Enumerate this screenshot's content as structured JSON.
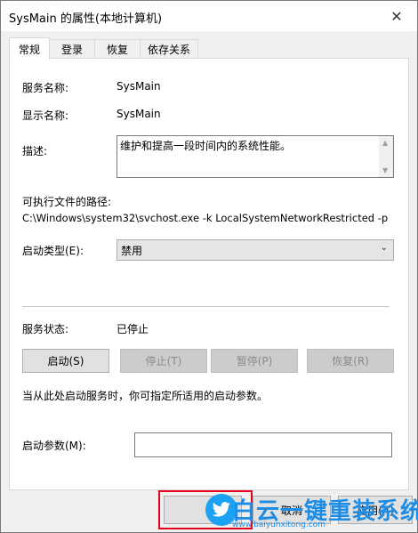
{
  "window": {
    "title": "SysMain 的属性(本地计算机)",
    "close_glyph": "✕"
  },
  "tabs": [
    {
      "label": "常规",
      "active": true
    },
    {
      "label": "登录",
      "active": false
    },
    {
      "label": "恢复",
      "active": false
    },
    {
      "label": "依存关系",
      "active": false
    }
  ],
  "general": {
    "service_name_label": "服务名称:",
    "service_name_value": "SysMain",
    "display_name_label": "显示名称:",
    "display_name_value": "SysMain",
    "description_label": "描述:",
    "description_value": "维护和提高一段时间内的系统性能。",
    "exe_path_label": "可执行文件的路径:",
    "exe_path_value": "C:\\Windows\\system32\\svchost.exe -k LocalSystemNetworkRestricted -p",
    "startup_type_label": "启动类型(E):",
    "startup_type_value": "禁用",
    "service_status_label": "服务状态:",
    "service_status_value": "已停止",
    "buttons": {
      "start": "启动(S)",
      "stop": "停止(T)",
      "pause": "暂停(P)",
      "resume": "恢复(R)"
    },
    "hint": "当从此处启动服务时，你可指定所适用的启动参数。",
    "start_params_label": "启动参数(M):",
    "start_params_value": ""
  },
  "footer": {
    "ok": "",
    "cancel": "取消",
    "apply": "应用(A)"
  },
  "watermark": {
    "title": "白云一键重装系统",
    "url": "www.baiyunxitong.com"
  },
  "colors": {
    "highlight": "#e8001c",
    "watermark": "#1d8de6"
  }
}
